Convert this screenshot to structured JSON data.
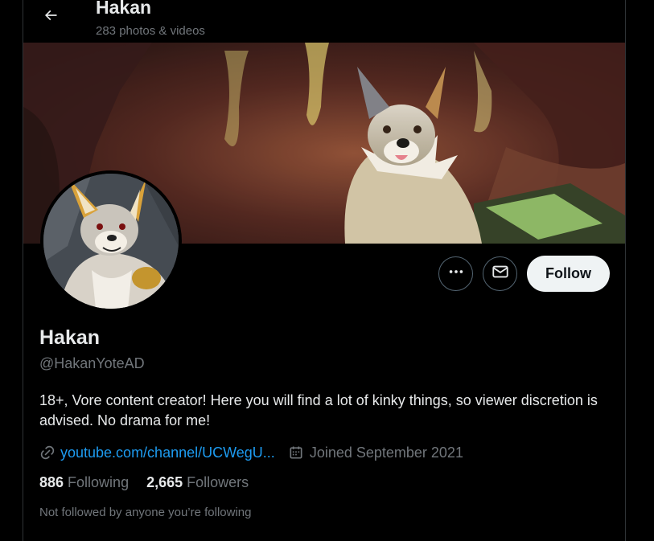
{
  "header": {
    "title": "Hakan",
    "subtitle": "283 photos & videos"
  },
  "profile": {
    "display_name": "Hakan",
    "handle": "@HakanYoteAD",
    "bio": "18+, Vore content creator! Here you will find a lot of kinky things, so viewer discretion is advised. No drama for me!",
    "website": "youtube.com/channel/UCWegU...",
    "joined": "Joined September 2021",
    "following_count": "886",
    "following_label": "Following",
    "followers_count": "2,665",
    "followers_label": "Followers",
    "follow_context": "Not followed by anyone you’re following"
  },
  "actions": {
    "follow_label": "Follow",
    "more_icon": "more-dots-icon",
    "message_icon": "mail-icon"
  },
  "colors": {
    "background": "#000000",
    "text_primary": "#e7e9ea",
    "text_secondary": "#71767b",
    "link": "#1d9bf0",
    "follow_button_bg": "#eff3f4"
  }
}
